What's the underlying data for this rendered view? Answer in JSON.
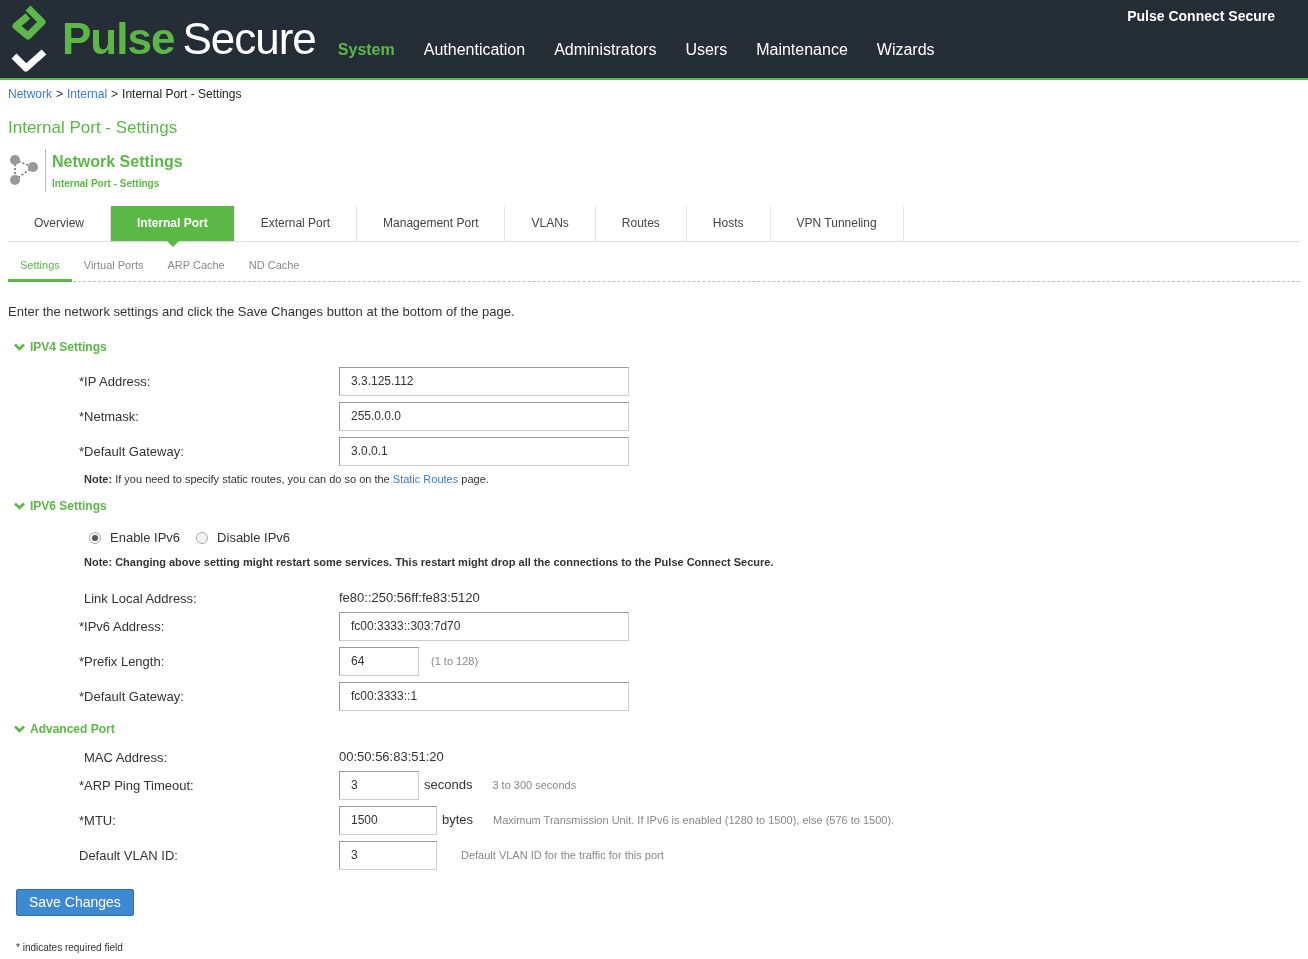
{
  "header": {
    "logo_primary": "Pulse",
    "logo_secondary": "Secure",
    "product": "Pulse Connect Secure",
    "nav": [
      {
        "label": "System",
        "selected": true
      },
      {
        "label": "Authentication",
        "selected": false
      },
      {
        "label": "Administrators",
        "selected": false
      },
      {
        "label": "Users",
        "selected": false
      },
      {
        "label": "Maintenance",
        "selected": false
      },
      {
        "label": "Wizards",
        "selected": false
      }
    ]
  },
  "breadcrumb": {
    "links": [
      "Network",
      "Internal"
    ],
    "separator": ">",
    "current": "Internal Port - Settings"
  },
  "page_title": "Internal Port - Settings",
  "section_header": {
    "title": "Network Settings",
    "subtitle": "Internal Port - Settings"
  },
  "tabs": [
    {
      "label": "Overview",
      "selected": false
    },
    {
      "label": "Internal Port",
      "selected": true
    },
    {
      "label": "External Port",
      "selected": false
    },
    {
      "label": "Management Port",
      "selected": false
    },
    {
      "label": "VLANs",
      "selected": false
    },
    {
      "label": "Routes",
      "selected": false
    },
    {
      "label": "Hosts",
      "selected": false
    },
    {
      "label": "VPN Tunneling",
      "selected": false
    }
  ],
  "subtabs": [
    {
      "label": "Settings",
      "selected": true
    },
    {
      "label": "Virtual Ports",
      "selected": false
    },
    {
      "label": "ARP Cache",
      "selected": false
    },
    {
      "label": "ND Cache",
      "selected": false
    }
  ],
  "intro": "Enter the network settings and click the Save Changes button at the bottom of the page.",
  "sections": [
    {
      "title": "IPV4 Settings",
      "expanded": true,
      "rows": [
        {
          "kind": "field",
          "label": "*IP Address:",
          "value": "3.3.125.112"
        },
        {
          "kind": "field",
          "label": "*Netmask:",
          "value": "255.0.0.0"
        },
        {
          "kind": "field",
          "label": "*Default Gateway:",
          "value": "3.0.0.1"
        },
        {
          "kind": "note",
          "bold": "Note:",
          "text": "If you need to specify static routes, you can do so on the",
          "link": "Static Routes",
          "after": "page."
        }
      ]
    },
    {
      "title": "IPV6 Settings",
      "expanded": true,
      "rows": [
        {
          "kind": "radio",
          "options": [
            {
              "label": "Enable IPv6",
              "selected": true
            },
            {
              "label": "Disable IPv6",
              "selected": false
            }
          ]
        },
        {
          "kind": "warning",
          "text": "Note: Changing above setting might restart some services. This restart might drop all the connections to the Pulse Connect Secure."
        },
        {
          "kind": "text",
          "label": "Link Local Address:",
          "value": "fe80::250:56ff:fe83:5120"
        },
        {
          "kind": "field",
          "label": "*IPv6 Address:",
          "value": "fc00:3333::303:7d70"
        },
        {
          "kind": "short-field",
          "label": "*Prefix Length:",
          "value": "64",
          "hint": "(1 to 128)"
        },
        {
          "kind": "field",
          "label": "*Default Gateway:",
          "value": "fc00:3333::1"
        }
      ]
    },
    {
      "title": "Advanced Port",
      "expanded": true,
      "rows": [
        {
          "kind": "text",
          "label": "MAC Address:",
          "value": "00:50:56:83:51:20"
        },
        {
          "kind": "short-field",
          "label": "*ARP Ping Timeout:",
          "value": "3",
          "unit": "seconds",
          "hint": "3 to 300 seconds"
        },
        {
          "kind": "medium-field",
          "label": "*MTU:",
          "value": "1500",
          "unit": "bytes",
          "hint": "Maximum Transmission Unit. If IPv6 is enabled (1280 to 1500), else (576 to 1500)."
        },
        {
          "kind": "medium-field",
          "label": "Default VLAN ID:",
          "value": "3",
          "hint": "Default VLAN ID for the traffic for this port"
        }
      ]
    }
  ],
  "save_button": "Save Changes",
  "footnote": "* indicates required field"
}
